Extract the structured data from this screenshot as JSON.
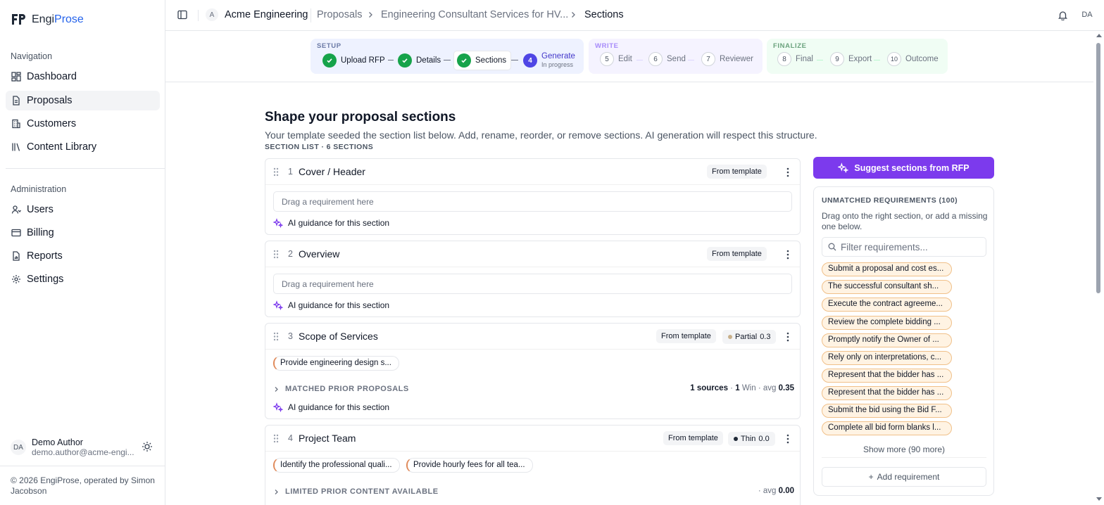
{
  "app": {
    "logo_prefix": "Engi",
    "logo_suffix": "Prose"
  },
  "sidebar": {
    "nav_label": "Navigation",
    "nav_items": [
      {
        "label": "Dashboard",
        "icon": "dashboard-icon"
      },
      {
        "label": "Proposals",
        "icon": "document-icon",
        "active": true
      },
      {
        "label": "Customers",
        "icon": "building-icon"
      },
      {
        "label": "Content Library",
        "icon": "library-icon"
      }
    ],
    "admin_label": "Administration",
    "admin_items": [
      {
        "label": "Users",
        "icon": "user-icon"
      },
      {
        "label": "Billing",
        "icon": "credit-card-icon"
      },
      {
        "label": "Reports",
        "icon": "report-icon"
      },
      {
        "label": "Settings",
        "icon": "gear-icon"
      }
    ],
    "user": {
      "initials": "DA",
      "name": "Demo Author",
      "email": "demo.author@acme-engi..."
    },
    "footer": "© 2026 EngiProse, operated by Simon Jacobson"
  },
  "topbar": {
    "org_initial": "A",
    "org_name": "Acme Engineering",
    "crumbs": [
      "Proposals",
      "Engineering Consultant Services for HV...",
      "Sections"
    ],
    "user_initials": "DA"
  },
  "stepper": {
    "phases": [
      "SETUP",
      "WRITE",
      "FINALIZE"
    ],
    "steps": [
      {
        "label": "Upload RFP",
        "state": "done"
      },
      {
        "label": "Details",
        "state": "done"
      },
      {
        "label": "Sections",
        "state": "done"
      },
      {
        "num": "4",
        "label": "Generate",
        "sub": "In progress",
        "state": "current"
      },
      {
        "num": "5",
        "label": "Edit"
      },
      {
        "num": "6",
        "label": "Send"
      },
      {
        "num": "7",
        "label": "Reviewer"
      },
      {
        "num": "8",
        "label": "Final"
      },
      {
        "num": "9",
        "label": "Export"
      },
      {
        "num": "10",
        "label": "Outcome"
      }
    ]
  },
  "main": {
    "title": "Shape your proposal sections",
    "subtitle": "Your template seeded the section list below. Add, rename, reorder, or remove sections. AI generation will respect this structure.",
    "list_label": "SECTION LIST · 6 SECTIONS",
    "drop_placeholder": "Drag a requirement here",
    "guidance_label": "AI guidance for this section",
    "template_badge": "From template",
    "sections": [
      {
        "num": "1",
        "title": "Cover / Header"
      },
      {
        "num": "2",
        "title": "Overview"
      },
      {
        "num": "3",
        "title": "Scope of Services",
        "status": "Partial",
        "score": "0.3",
        "status_color": "#c8b08a",
        "reqs": [
          "Provide engineering design s..."
        ],
        "matched_label": "MATCHED PRIOR PROPOSALS",
        "stats": {
          "sources": "1 sources",
          "wins": "1",
          "win_label": "Win",
          "avg_label": "avg",
          "avg": "0.35"
        }
      },
      {
        "num": "4",
        "title": "Project Team",
        "status": "Thin",
        "score": "0.0",
        "status_color": "#1f2937",
        "reqs": [
          "Identify the professional quali...",
          "Provide hourly fees for all tea..."
        ],
        "matched_label": "LIMITED PRIOR CONTENT AVAILABLE",
        "stats": {
          "avg_label": "avg",
          "avg": "0.00"
        }
      }
    ]
  },
  "panel": {
    "suggest_label": "Suggest sections from RFP",
    "title": "UNMATCHED REQUIREMENTS (100)",
    "hint": "Drag onto the right section, or add a missing one below.",
    "filter_placeholder": "Filter requirements...",
    "requirements": [
      "Submit a proposal and cost es...",
      "The successful consultant sh...",
      "Execute the contract agreeme...",
      "Review the complete bidding ...",
      "Promptly notify the Owner of ...",
      "Rely only on interpretations, c...",
      "Represent that the bidder has ...",
      "Represent that the bidder has ...",
      "Submit the bid using the Bid F...",
      "Complete all bid form blanks l..."
    ],
    "show_more": "Show more (90 more)",
    "add_label": "Add requirement"
  },
  "colors": {
    "accent": "#7c3aed",
    "current_step": "#4f46e5",
    "done_step": "#16a34a",
    "req_chip_bg": "#fff3e3"
  }
}
